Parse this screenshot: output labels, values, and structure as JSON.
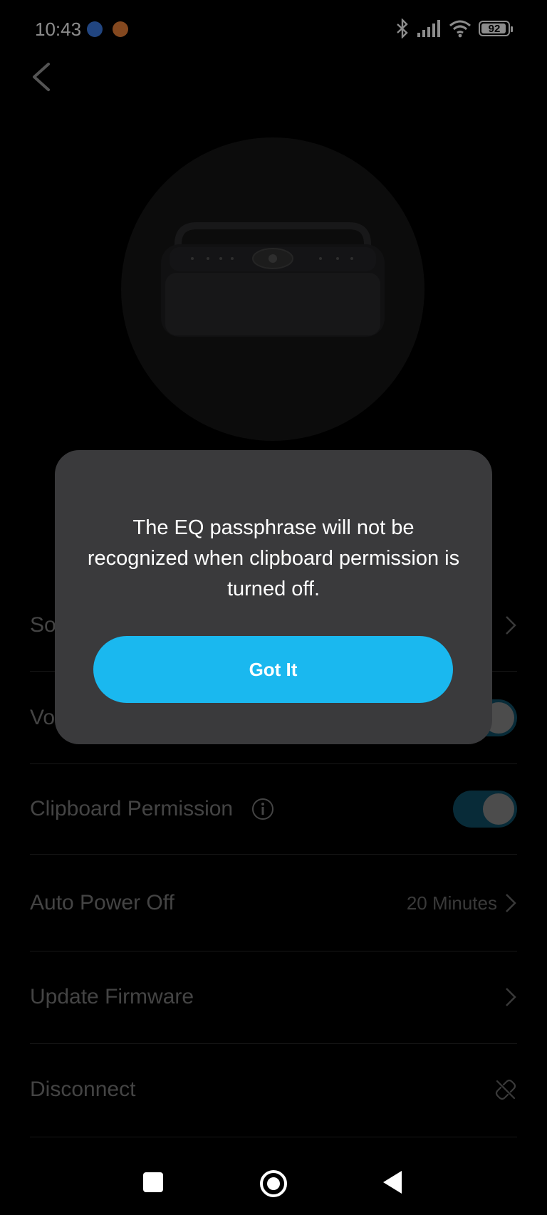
{
  "status_bar": {
    "time": "10:43",
    "battery": "92"
  },
  "dialog": {
    "message": "The EQ passphrase will not be recognized when clipboard permission is turned off.",
    "button_label": "Got It"
  },
  "settings": {
    "row_sound_partial": "So",
    "row_voice_partial": "Vo",
    "clipboard_permission": "Clipboard Permission",
    "auto_power_off": "Auto Power Off",
    "auto_power_off_value": "20 Minutes",
    "update_firmware": "Update Firmware",
    "disconnect": "Disconnect"
  },
  "colors": {
    "accent": "#1ab8ef",
    "dialog_bg": "#3a3a3c",
    "toggle_on": "#0f4f66"
  }
}
